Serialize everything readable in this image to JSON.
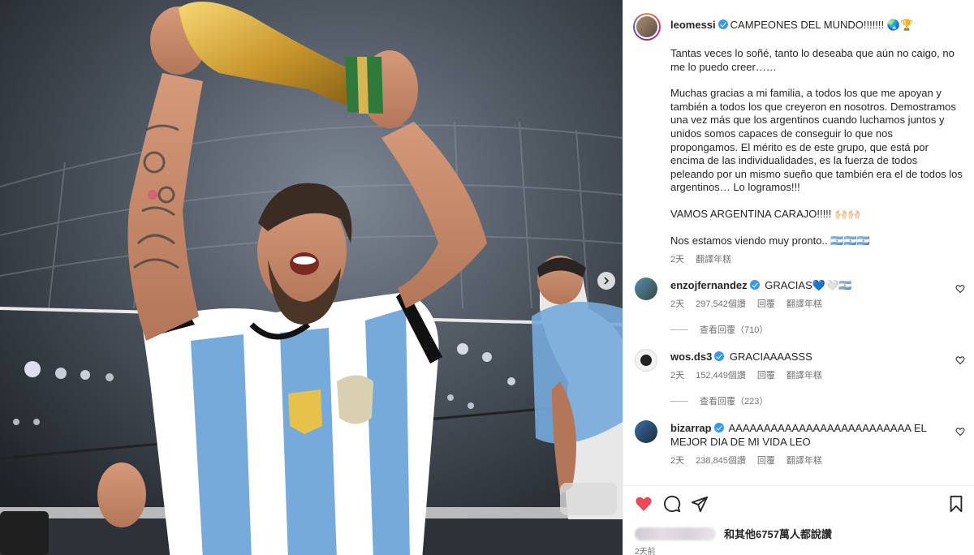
{
  "post": {
    "author": "leomessi",
    "caption_title": "CAMPEONES DEL MUNDO!!!!!!! 🌏🏆",
    "caption_paragraphs": [
      "Tantas veces lo soñé, tanto lo deseaba que aún no caigo, no me lo puedo creer……",
      "Muchas gracias a mi familia, a todos los que me apoyan y también a todos los que creyeron en nosotros. Demostramos una vez más que los argentinos cuando luchamos juntos y unidos somos capaces de conseguir lo que nos propongamos. El mérito es de este grupo, que está por encima de las individualidades, es la fuerza de todos peleando por un mismo sueño que también era el de todos los argentinos… Lo logramos!!!",
      "VAMOS ARGENTINA CARAJO!!!!! 🙌🏻🙌🏻",
      "Nos estamos viendo muy pronto.. 🇦🇷🇦🇷🇦🇷"
    ],
    "caption_time": "2天",
    "translate_label": "翻譯年糕"
  },
  "comments": [
    {
      "user": "enzojfernandez",
      "text": "GRACIAS💙🤍🇦🇷",
      "time": "2天",
      "likes": "297,542個讚",
      "reply": "回覆",
      "translate": "翻譯年糕",
      "view_replies": "查看回覆（710）"
    },
    {
      "user": "wos.ds3",
      "text": "GRACIAAAASSS",
      "time": "2天",
      "likes": "152,449個讚",
      "reply": "回覆",
      "translate": "翻譯年糕",
      "view_replies": "查看回覆（223）"
    },
    {
      "user": "bizarrap",
      "text": "AAAAAAAAAAAAAAAAAAAAAAAAAA EL MEJOR DIA DE MI VIDA LEO",
      "time": "2天",
      "likes": "238,845個讚",
      "reply": "回覆",
      "translate": "翻譯年糕"
    }
  ],
  "footer": {
    "likes_text": "和其他6757萬人都說讚",
    "posted_time": "2天前"
  },
  "icons": {
    "like": "heart-filled-icon",
    "comment": "comment-icon",
    "share": "paper-plane-icon",
    "save": "bookmark-icon",
    "carousel_next": "chevron-right-icon"
  },
  "colors": {
    "like_red": "#ed4956",
    "verified_blue": "#3897f0",
    "argentina_blue": "#75aadb"
  }
}
